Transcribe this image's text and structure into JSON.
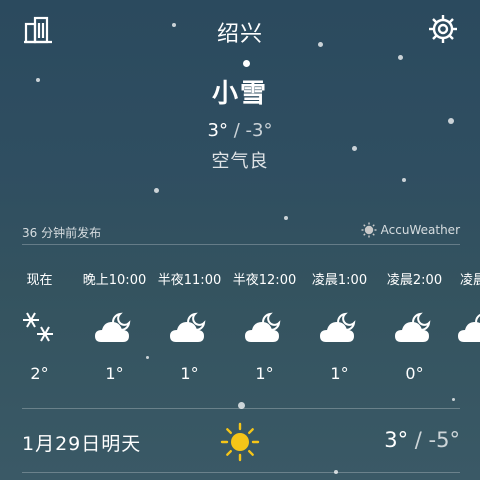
{
  "header": {
    "city": "绍兴",
    "city_list_icon": "building-icon",
    "settings_icon": "gear-icon"
  },
  "current": {
    "condition": "小雪",
    "high": "3°",
    "separator": "/",
    "low": "-3°",
    "air_quality": "空气良"
  },
  "publish": {
    "time_text": "36 分钟前发布",
    "provider": "AccuWeather",
    "provider_icon": "accuweather-sun-icon"
  },
  "hourly": [
    {
      "label": "现在",
      "icon": "snow-icon",
      "temp": "2°"
    },
    {
      "label": "晚上10:00",
      "icon": "cloudy-night-icon",
      "temp": "1°"
    },
    {
      "label": "半夜11:00",
      "icon": "cloudy-night-icon",
      "temp": "1°"
    },
    {
      "label": "半夜12:00",
      "icon": "cloudy-night-icon",
      "temp": "1°"
    },
    {
      "label": "凌晨1:00",
      "icon": "cloudy-night-icon",
      "temp": "1°"
    },
    {
      "label": "凌晨2:00",
      "icon": "cloudy-night-icon",
      "temp": "0°"
    },
    {
      "label": "凌晨",
      "icon": "cloudy-night-icon",
      "temp": ""
    }
  ],
  "daily": {
    "date": "1月29日明天",
    "icon": "sun-icon",
    "high": "3°",
    "separator": "/",
    "low": "-5°"
  },
  "colors": {
    "background_top": "#2b4a5e",
    "background_bottom": "#3a5966",
    "sun": "#f5c518"
  }
}
